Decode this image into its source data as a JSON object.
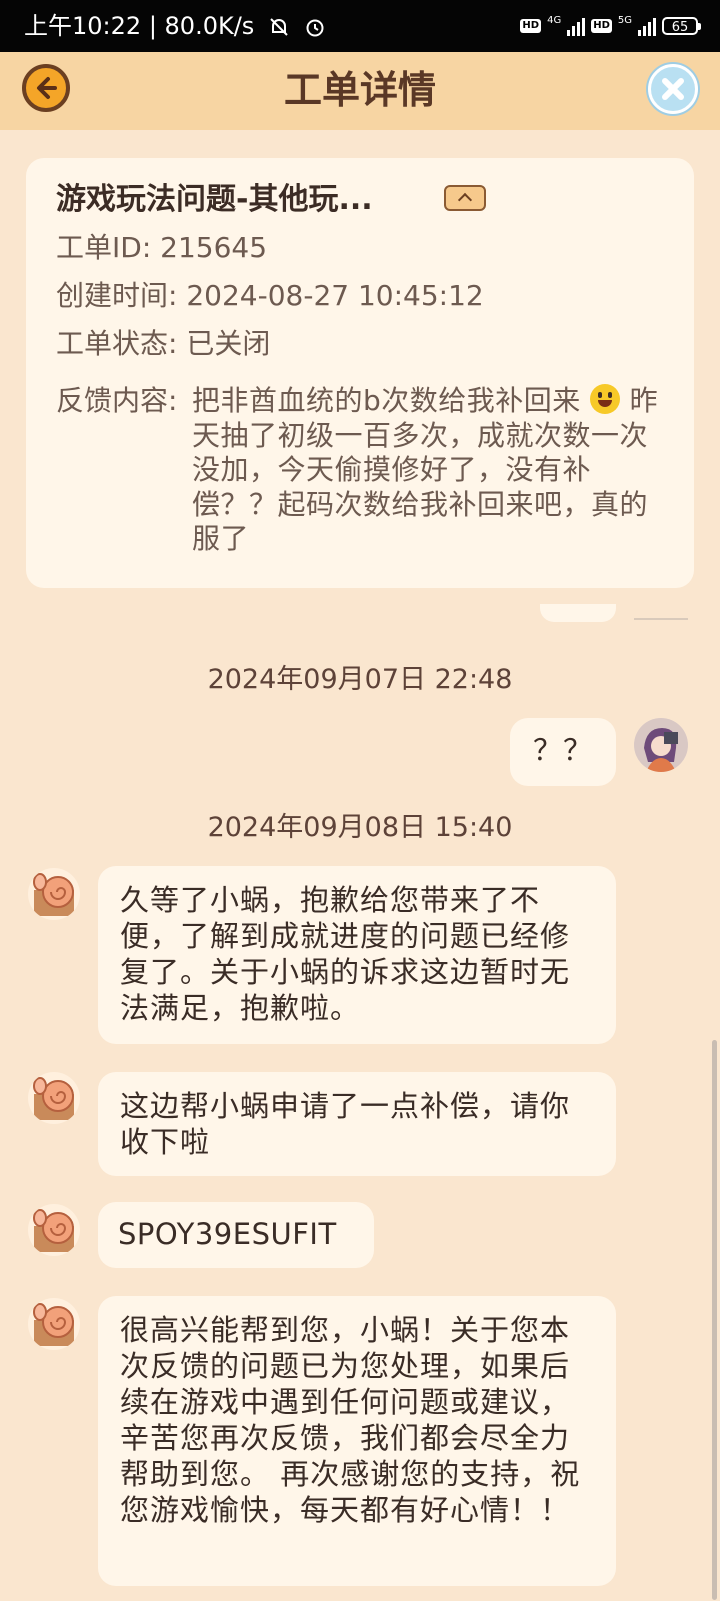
{
  "status_bar": {
    "time": "上午10:22",
    "net_speed": "80.0K/s",
    "hd1": "HD",
    "net1": "4G",
    "hd2": "HD",
    "net2": "5G",
    "battery": "65"
  },
  "header": {
    "title": "工单详情",
    "back_icon": "back-arrow-icon",
    "close_icon": "close-x-icon"
  },
  "ticket": {
    "title": "游戏玩法问题-其他玩...",
    "id_label": "工单ID:",
    "id_value": "215645",
    "created_label": "创建时间:",
    "created_value": "2024-08-27 10:45:12",
    "status_label": "工单状态:",
    "status_value": "已关闭",
    "feedback_label": "反馈内容:",
    "feedback_part1": "把非酋血统的b次数给我补回来",
    "feedback_part2": " 昨天抽了初级一百多次，成就次数一次没加，今天偷摸修好了，没有补偿？？起码次数给我补回来吧，真的服了"
  },
  "chat": {
    "timestamp1": "2024年09月07日 22:48",
    "user_msg": "？？",
    "timestamp2": "2024年09月08日 15:40",
    "support_msgs": [
      "久等了小蜗，抱歉给您带来了不便，了解到成就进度的问题已经修复了。关于小蜗的诉求这边暂时无法满足，抱歉啦。",
      "这边帮小蜗申请了一点补偿，请你收下啦",
      "SPOY39ESUFIT",
      "很高兴能帮到您，小蜗！关于您本次反馈的问题已为您处理，如果后续在游戏中遇到任何问题或建议，辛苦您再次反馈，我们都会尽全力帮助到您。 再次感谢您的支持，祝您游戏愉快，每天都有好心情！！"
    ]
  },
  "colors": {
    "page_bg": "#fae6cf",
    "header_bg": "#f7d5a3",
    "card_bg": "#fff6e9",
    "title_text": "#5a3826"
  }
}
